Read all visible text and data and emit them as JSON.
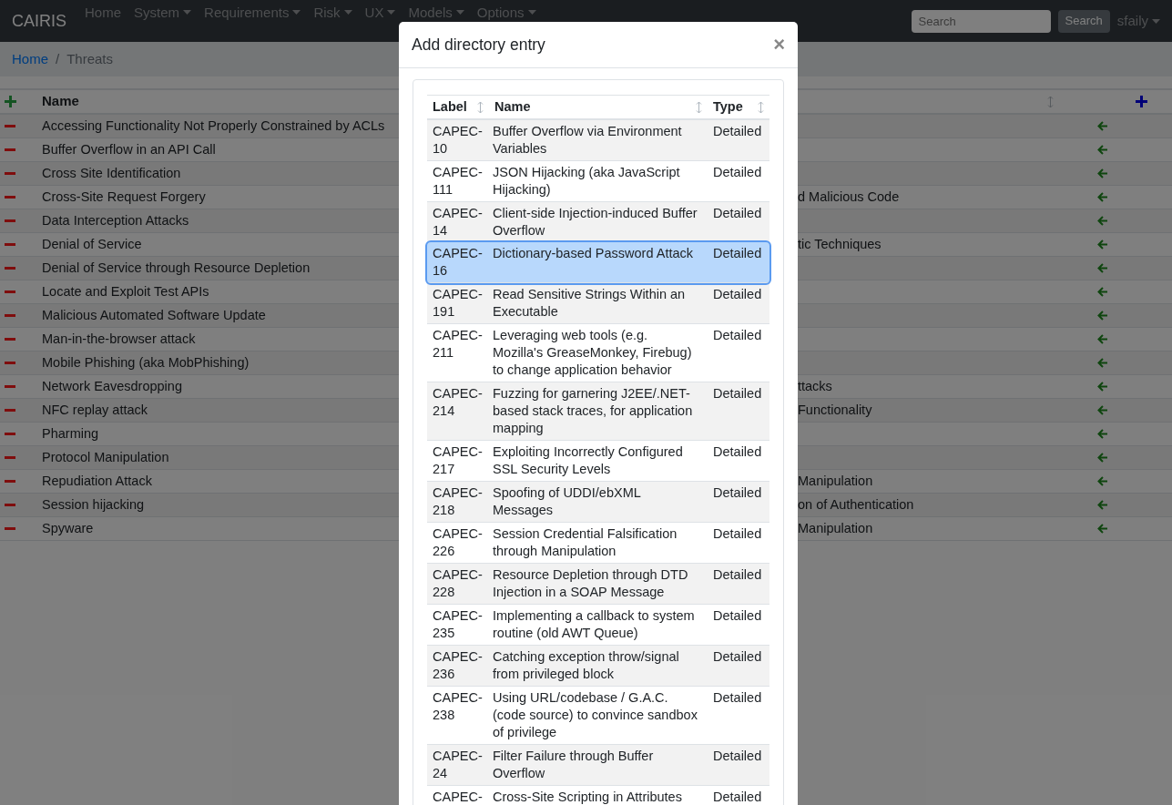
{
  "navbar": {
    "brand": "CAIRIS",
    "items": [
      {
        "label": "Home",
        "dropdown": false
      },
      {
        "label": "System",
        "dropdown": true
      },
      {
        "label": "Requirements",
        "dropdown": true
      },
      {
        "label": "Risk",
        "dropdown": true
      },
      {
        "label": "UX",
        "dropdown": true
      },
      {
        "label": "Models",
        "dropdown": true
      },
      {
        "label": "Options",
        "dropdown": true
      }
    ],
    "search": {
      "placeholder": "Search"
    },
    "search_button": "Search",
    "user": "sfaily"
  },
  "breadcrumb_separator": "/",
  "breadcrumb": [
    {
      "label": "Home",
      "kind": "link"
    },
    {
      "label": "Threats",
      "kind": "current"
    }
  ],
  "threats_table": {
    "columns": [
      "Name"
    ],
    "rows": [
      {
        "name": "Accessing Functionality Not Properly Constrained by ACLs"
      },
      {
        "name": "Buffer Overflow in an API Call"
      },
      {
        "name": "Cross Site Identification"
      },
      {
        "name": "Cross-Site Request Forgery",
        "column_3": "d Malicious Code"
      },
      {
        "name": "Data Interception Attacks"
      },
      {
        "name": "Denial of Service",
        "column_3": "tic Techniques"
      },
      {
        "name": "Denial of Service through Resource Depletion"
      },
      {
        "name": "Locate and Exploit Test APIs"
      },
      {
        "name": "Malicious Automated Software Update"
      },
      {
        "name": "Man-in-the-browser attack"
      },
      {
        "name": "Mobile Phishing (aka MobPhishing)"
      },
      {
        "name": "Network Eavesdropping",
        "column_3": "ttacks"
      },
      {
        "name": "NFC replay attack",
        "column_3": "Functionality"
      },
      {
        "name": "Pharming"
      },
      {
        "name": "Protocol Manipulation"
      },
      {
        "name": "Repudiation Attack",
        "column_3": "Manipulation"
      },
      {
        "name": "Session hijacking",
        "column_3": "on of Authentication"
      },
      {
        "name": "Spyware",
        "column_3": "Manipulation"
      }
    ]
  },
  "modal": {
    "title": "Add directory entry",
    "close": "×",
    "table": {
      "columns": [
        "Label",
        "Name",
        "Type"
      ],
      "rows": [
        {
          "label": "CAPEC-10",
          "name": "Buffer Overflow via Environment Variables",
          "type": "Detailed",
          "selected": false
        },
        {
          "label": "CAPEC-111",
          "name": "JSON Hijacking (aka JavaScript Hijacking)",
          "type": "Detailed",
          "selected": false
        },
        {
          "label": "CAPEC-14",
          "name": "Client-side Injection-induced Buffer Overflow",
          "type": "Detailed",
          "selected": false
        },
        {
          "label": "CAPEC-16",
          "name": "Dictionary-based Password Attack",
          "type": "Detailed",
          "selected": true
        },
        {
          "label": "CAPEC-191",
          "name": "Read Sensitive Strings Within an Executable",
          "type": "Detailed",
          "selected": false
        },
        {
          "label": "CAPEC-211",
          "name": "Leveraging web tools (e.g. Mozilla's GreaseMonkey, Firebug) to change application behavior",
          "type": "Detailed",
          "selected": false
        },
        {
          "label": "CAPEC-214",
          "name": "Fuzzing for garnering J2EE/.NET-based stack traces, for application mapping",
          "type": "Detailed",
          "selected": false
        },
        {
          "label": "CAPEC-217",
          "name": "Exploiting Incorrectly Configured SSL Security Levels",
          "type": "Detailed",
          "selected": false
        },
        {
          "label": "CAPEC-218",
          "name": "Spoofing of UDDI/ebXML Messages",
          "type": "Detailed",
          "selected": false
        },
        {
          "label": "CAPEC-226",
          "name": "Session Credential Falsification through Manipulation",
          "type": "Detailed",
          "selected": false
        },
        {
          "label": "CAPEC-228",
          "name": "Resource Depletion through DTD Injection in a SOAP Message",
          "type": "Detailed",
          "selected": false
        },
        {
          "label": "CAPEC-235",
          "name": "Implementing a callback to system routine (old AWT Queue)",
          "type": "Detailed",
          "selected": false
        },
        {
          "label": "CAPEC-236",
          "name": "Catching exception throw/signal from privileged block",
          "type": "Detailed",
          "selected": false
        },
        {
          "label": "CAPEC-238",
          "name": "Using URL/codebase / G.A.C. (code source) to convince sandbox of privilege",
          "type": "Detailed",
          "selected": false
        },
        {
          "label": "CAPEC-24",
          "name": "Filter Failure through Buffer Overflow",
          "type": "Detailed",
          "selected": false
        },
        {
          "label": "CAPEC-",
          "name": "Cross-Site Scripting in Attributes",
          "type": "Detailed",
          "selected": false
        }
      ]
    }
  }
}
